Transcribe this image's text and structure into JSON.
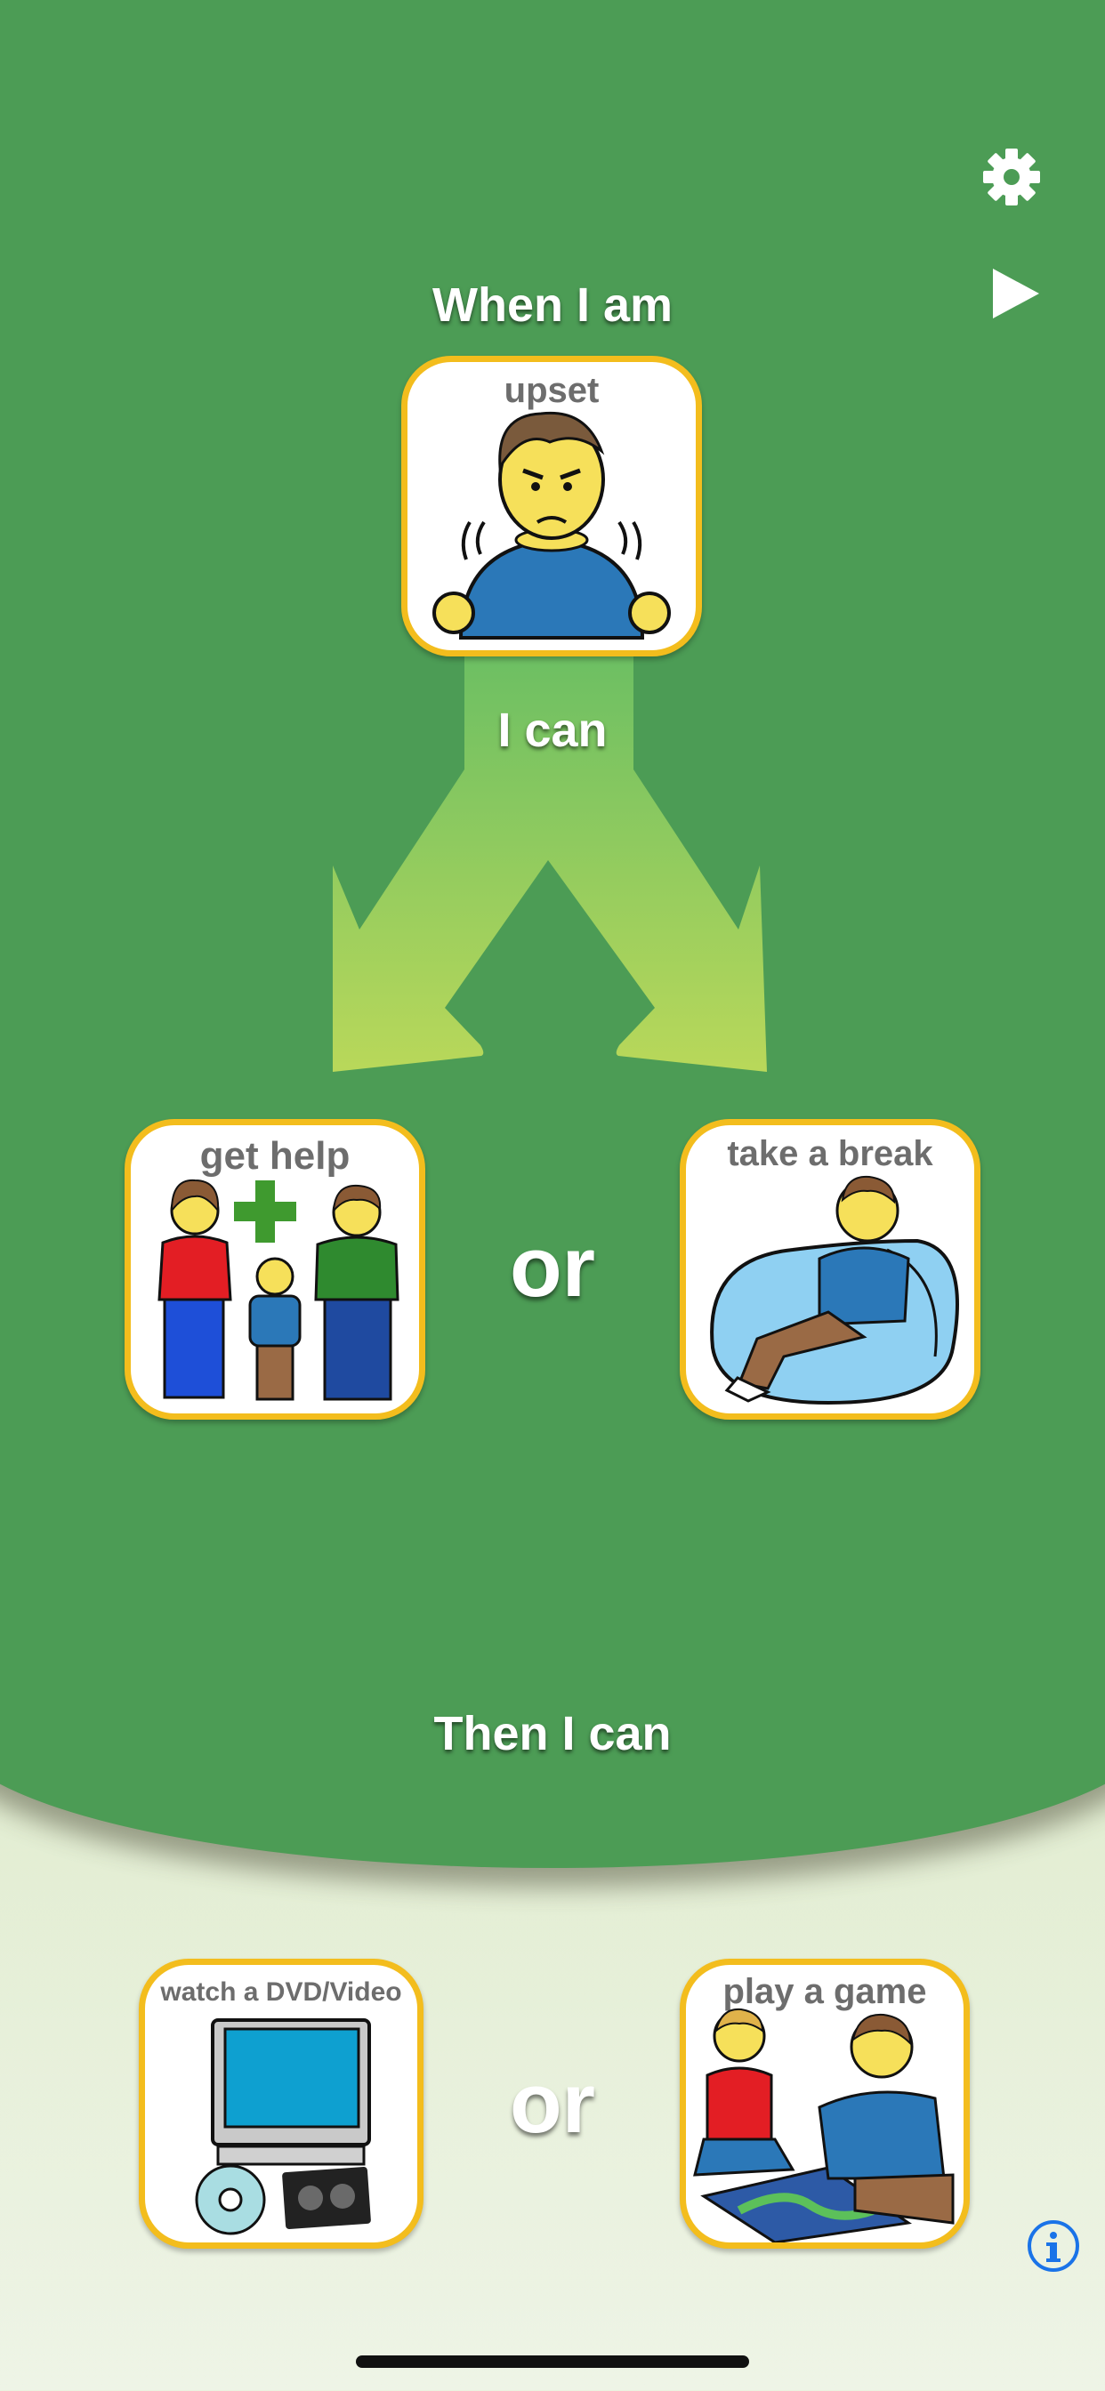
{
  "header": {
    "when_label": "When I am",
    "i_can_label": "I can",
    "then_label": "Then I can"
  },
  "feeling_card": {
    "label": "upset"
  },
  "choices": [
    {
      "label": "get help"
    },
    {
      "label": "take a break"
    }
  ],
  "rewards": [
    {
      "label": "watch a DVD/Video"
    },
    {
      "label": "play a game"
    }
  ],
  "or_label": "or",
  "icons": {
    "settings": "gear-icon",
    "play": "play-icon",
    "info": "info-icon"
  },
  "colors": {
    "green_background": "#4c9c55",
    "card_border": "#f3bd1d",
    "arrow_top": "#6cbf63",
    "arrow_bottom": "#b9d85a",
    "info_blue": "#1a73e8"
  }
}
